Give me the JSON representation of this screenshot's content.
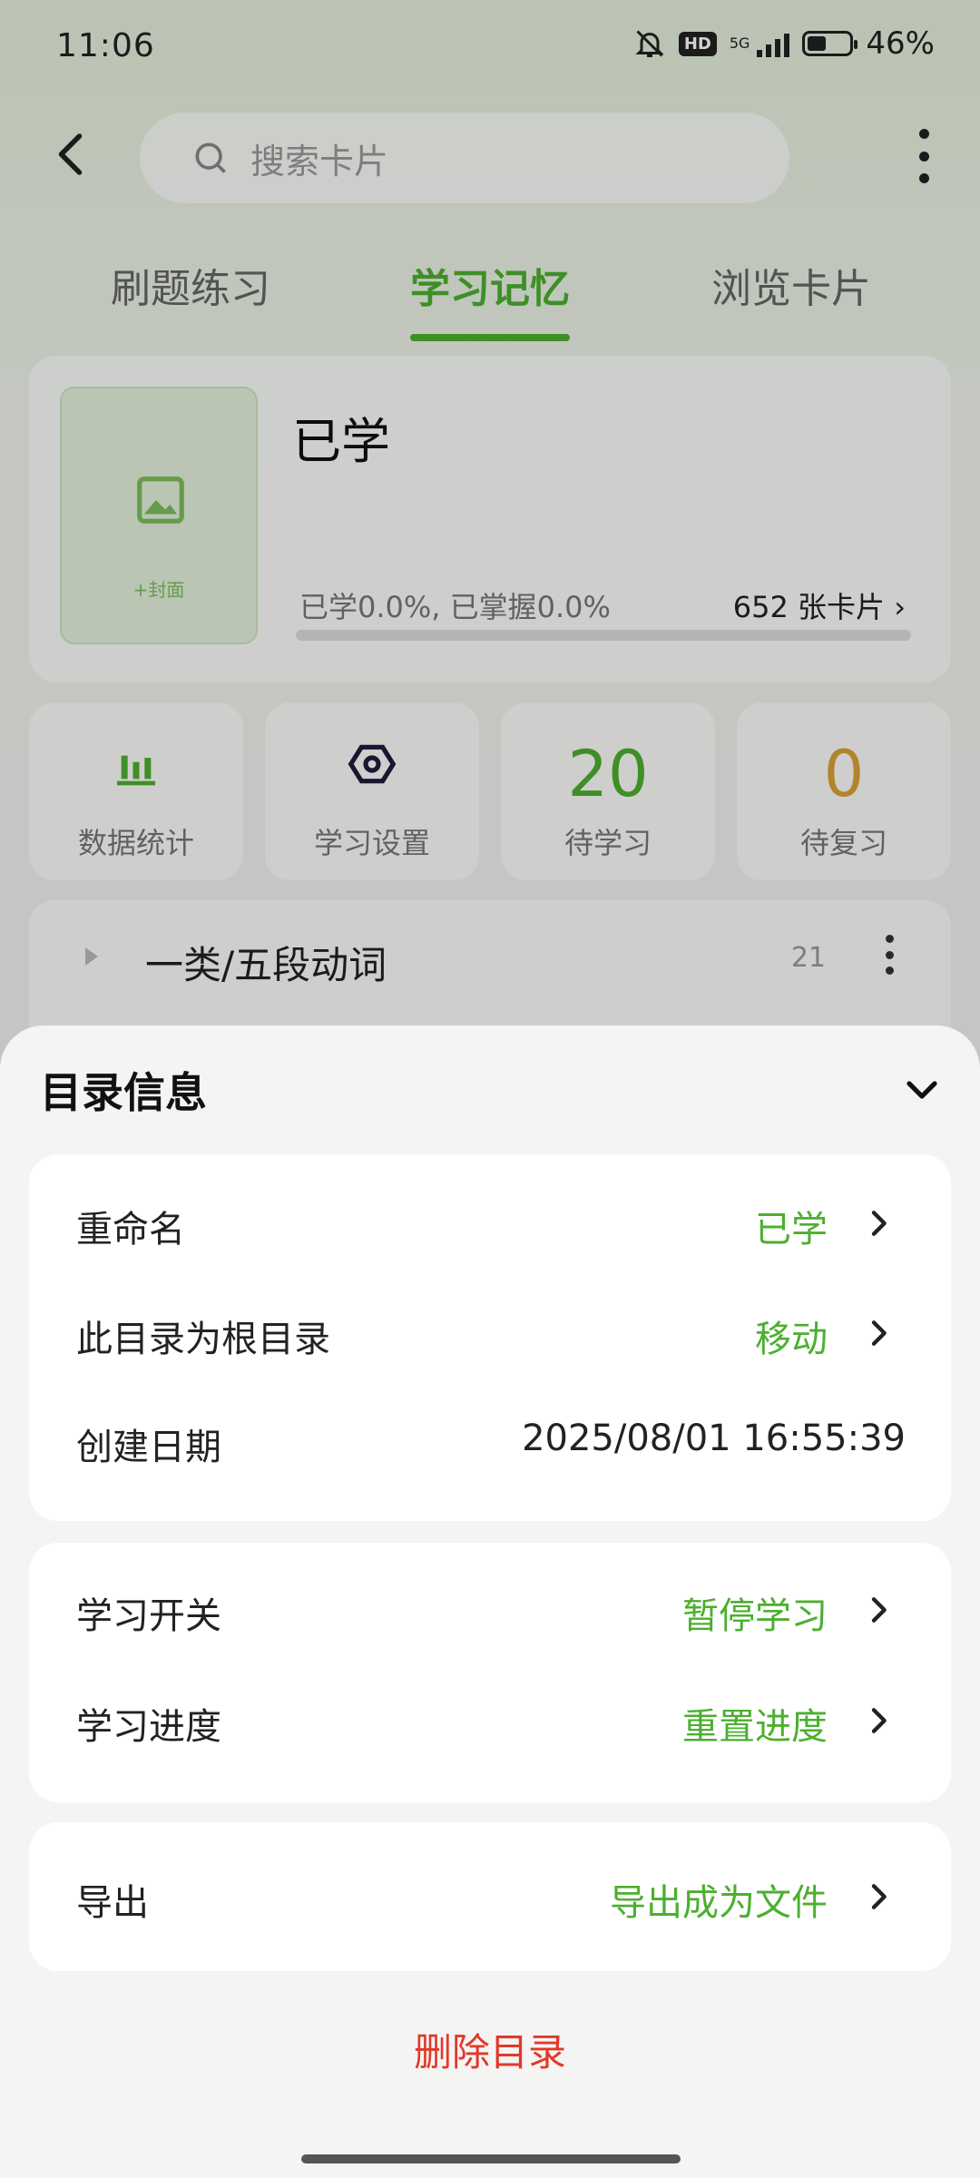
{
  "status_bar": {
    "time": "11:06",
    "hd_badge": "HD",
    "network": "5G",
    "battery": "46%"
  },
  "search": {
    "placeholder": "搜索卡片"
  },
  "tabs": [
    {
      "label": "刷题练习",
      "active": false
    },
    {
      "label": "学习记忆",
      "active": true
    },
    {
      "label": "浏览卡片",
      "active": false
    }
  ],
  "deck": {
    "title": "已学",
    "cover_label": "+封面",
    "progress_text": "已学0.0%, 已掌握0.0%",
    "card_count": "652 张卡片 ›",
    "progress_fraction": 0.0
  },
  "stats": {
    "data_stats_label": "数据统计",
    "study_settings_label": "学习设置",
    "to_learn_value": "20",
    "to_learn_label": "待学习",
    "to_review_value": "0",
    "to_review_label": "待复习"
  },
  "folder": {
    "name": "一类/五段动词",
    "count": "21"
  },
  "sheet": {
    "title": "目录信息",
    "group1": {
      "rename_label": "重命名",
      "rename_value": "已学",
      "root_label": "此目录为根目录",
      "root_value": "移动",
      "created_label": "创建日期",
      "created_value": "2025/08/01 16:55:39"
    },
    "group2": {
      "switch_label": "学习开关",
      "switch_value": "暂停学习",
      "progress_label": "学习进度",
      "progress_value": "重置进度"
    },
    "group3": {
      "export_label": "导出",
      "export_value": "导出成为文件"
    },
    "delete_label": "删除目录"
  },
  "colors": {
    "accent_green": "#4caf2f",
    "review_orange": "#d9a136",
    "delete_red": "#e0392b"
  }
}
